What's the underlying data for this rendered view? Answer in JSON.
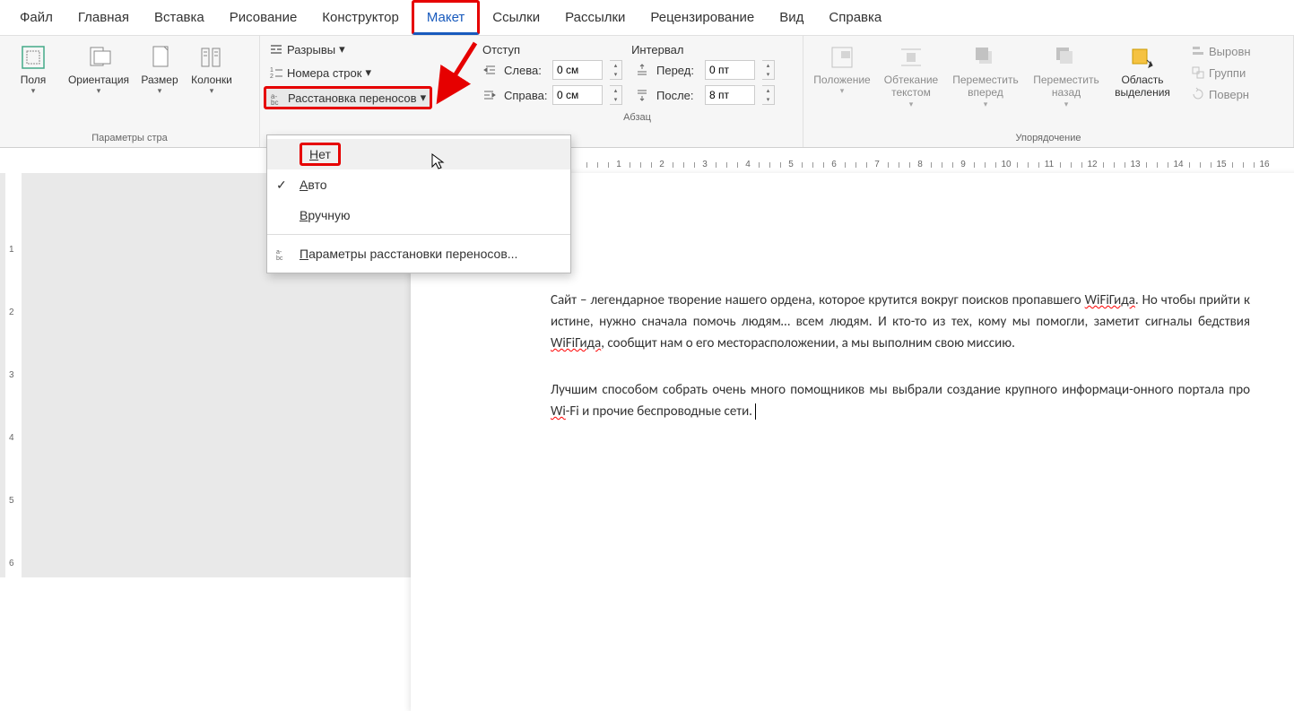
{
  "tabs": {
    "file": "Файл",
    "home": "Главная",
    "insert": "Вставка",
    "draw": "Рисование",
    "design": "Конструктор",
    "layout": "Макет",
    "references": "Ссылки",
    "mailings": "Рассылки",
    "review": "Рецензирование",
    "view": "Вид",
    "help": "Справка"
  },
  "ribbon": {
    "page_setup": {
      "margins": "Поля",
      "orientation": "Ориентация",
      "size": "Размер",
      "columns": "Колонки",
      "breaks": "Разрывы",
      "line_numbers": "Номера строк",
      "hyphenation": "Расстановка переносов",
      "group_label": "Параметры стра"
    },
    "paragraph": {
      "indent_label": "Отступ",
      "spacing_label": "Интервал",
      "left_label": "Слева:",
      "right_label": "Справа:",
      "before_label": "Перед:",
      "after_label": "После:",
      "left_val": "0 см",
      "right_val": "0 см",
      "before_val": "0 пт",
      "after_val": "8 пт",
      "group_label": "Абзац"
    },
    "arrange": {
      "position": "Положение",
      "wrap": "Обтекание текстом",
      "forward": "Переместить вперед",
      "backward": "Переместить назад",
      "selection_pane": "Область выделения",
      "align": "Выровн",
      "group": "Группи",
      "rotate": "Поверн",
      "group_label": "Упорядочение"
    }
  },
  "dropdown": {
    "none": "Нет",
    "auto": "Авто",
    "manual": "Вручную",
    "options": "Параметры расстановки переносов..."
  },
  "ruler_numbers": [
    "1",
    "2",
    "3",
    "4",
    "5",
    "6",
    "7",
    "8",
    "9",
    "10",
    "11",
    "12",
    "13",
    "14",
    "15",
    "16"
  ],
  "ruler_v_numbers": [
    "1",
    "2",
    "3",
    "4",
    "5",
    "6"
  ],
  "document": {
    "p1_a": "Сайт – легендарное творение нашего ордена, которое крутится вокруг поисков пропавшего ",
    "p1_w1": "WiFiГида",
    "p1_b": ". Но чтобы прийти к истине, нужно сначала помочь людям… всем людям. И кто-то из тех, кому мы помогли, заметит сигналы бедствия ",
    "p1_w2": "WiFiГида",
    "p1_c": ", сообщит нам о его месторасположении, а мы выполним свою миссию.",
    "p2_a": "Лучшим способом собрать очень много помощников мы выбрали создание крупного информаци-онного портала про ",
    "p2_w1": "Wi",
    "p2_b": "-Fi и прочие беспроводные сети."
  }
}
